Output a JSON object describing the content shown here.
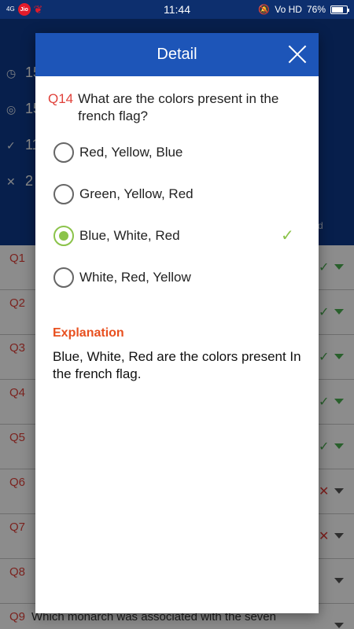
{
  "status_bar": {
    "network": "4G",
    "carrier_badge": "Jio",
    "time": "11:44",
    "volte": "Vo HD",
    "battery": "76%",
    "battery_level": 0.76
  },
  "background": {
    "stats": [
      "15",
      "15",
      "11",
      "2"
    ],
    "side_note": "d",
    "rows": [
      {
        "num": "Q1",
        "text": "",
        "mark": "✓",
        "status": "correct"
      },
      {
        "num": "Q2",
        "text": "",
        "mark": "✓",
        "status": "correct"
      },
      {
        "num": "Q3",
        "text": "",
        "mark": "✓",
        "status": "correct"
      },
      {
        "num": "Q4",
        "text": "",
        "mark": "✓",
        "status": "correct"
      },
      {
        "num": "Q5",
        "text": "",
        "mark": "✓",
        "status": "correct"
      },
      {
        "num": "Q6",
        "text": "",
        "mark": "✕",
        "status": "wrong"
      },
      {
        "num": "Q7",
        "text": "",
        "mark": "✕",
        "status": "wrong"
      },
      {
        "num": "Q8",
        "text": "",
        "mark": "",
        "status": "none"
      },
      {
        "num": "Q9",
        "text": "Which monarch was associated with the seven",
        "mark": "",
        "status": "none"
      }
    ]
  },
  "dialog": {
    "title": "Detail",
    "question_number": "Q14",
    "question_text": "What are the colors present in the french flag?",
    "options": [
      {
        "label": "Red, Yellow, Blue",
        "selected": false,
        "correct": false
      },
      {
        "label": "Green, Yellow, Red",
        "selected": false,
        "correct": false
      },
      {
        "label": "Blue, White, Red",
        "selected": true,
        "correct": true
      },
      {
        "label": "White, Red, Yellow",
        "selected": false,
        "correct": false
      }
    ],
    "correct_mark": "✓",
    "explanation_title": "Explanation",
    "explanation_text": "Blue, White, Red are the colors present In the french flag."
  },
  "colors": {
    "header_blue": "#1d55b8",
    "accent_green": "#8bc34a",
    "question_number_red": "#e0413a",
    "explanation_orange": "#e8501f"
  }
}
